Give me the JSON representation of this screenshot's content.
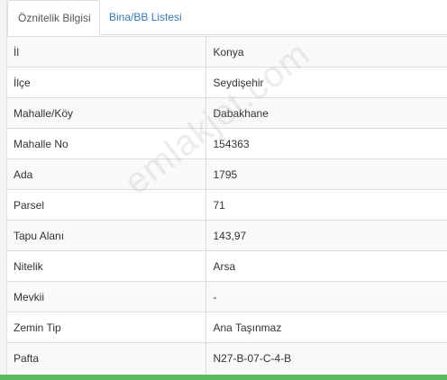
{
  "tabs": [
    {
      "label": "Öznitelik Bilgisi",
      "active": true
    },
    {
      "label": "Bina/BB Listesi",
      "active": false
    }
  ],
  "rows": [
    {
      "label": "İl",
      "value": "Konya"
    },
    {
      "label": "İlçe",
      "value": "Seydişehir"
    },
    {
      "label": "Mahalle/Köy",
      "value": "Dabakhane"
    },
    {
      "label": "Mahalle No",
      "value": "154363"
    },
    {
      "label": "Ada",
      "value": "1795"
    },
    {
      "label": "Parsel",
      "value": "71"
    },
    {
      "label": "Tapu Alanı",
      "value": "143,97"
    },
    {
      "label": "Nitelik",
      "value": "Arsa"
    },
    {
      "label": "Mevkii",
      "value": "-"
    },
    {
      "label": "Zemin Tip",
      "value": "Ana Taşınmaz"
    },
    {
      "label": "Pafta",
      "value": "N27-B-07-C-4-B"
    }
  ],
  "watermark": "emlakjet.com",
  "colors": {
    "tab_link": "#337ab7",
    "bottom_bar": "#5cb85c",
    "stripe": "#f9f9f9",
    "border": "#dddddd"
  }
}
